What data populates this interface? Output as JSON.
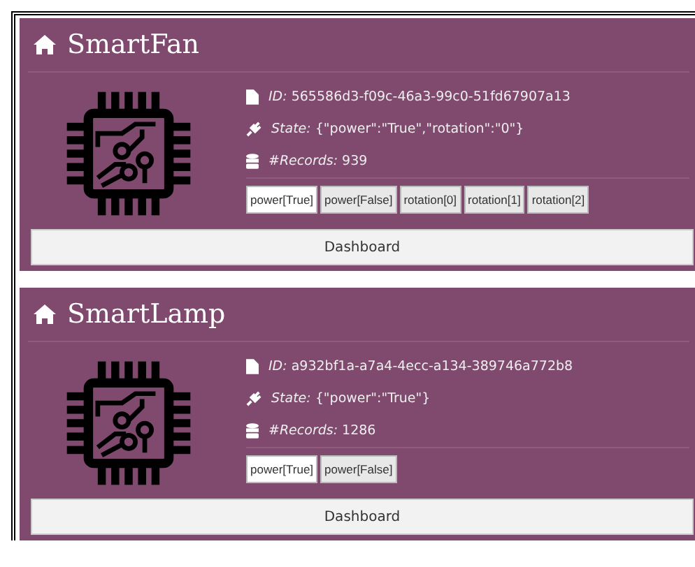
{
  "devices": [
    {
      "title": "SmartFan",
      "id": "*ID:* 565586d3-f09c-46a3-99c0-51fd67907a13",
      "state": "*State:* {\"power\":\"True\",\"rotation\":\"0\"}",
      "records": "*#Records:* 939",
      "actions": [
        {
          "label": "power[True]",
          "selected": true
        },
        {
          "label": "power[False]",
          "selected": false
        },
        {
          "label": "rotation[0]",
          "selected": false
        },
        {
          "label": "rotation[1]",
          "selected": false
        },
        {
          "label": "rotation[2]",
          "selected": false
        }
      ],
      "dashboard": "Dashboard"
    },
    {
      "title": "SmartLamp",
      "id": "*ID:* a932bf1a-a7a4-4ecc-a134-389746a772b8",
      "state": "*State:* {\"power\":\"True\"}",
      "records": "*#Records:* 1286",
      "actions": [
        {
          "label": "power[True]",
          "selected": true
        },
        {
          "label": "power[False]",
          "selected": false
        }
      ],
      "dashboard": "Dashboard"
    }
  ]
}
